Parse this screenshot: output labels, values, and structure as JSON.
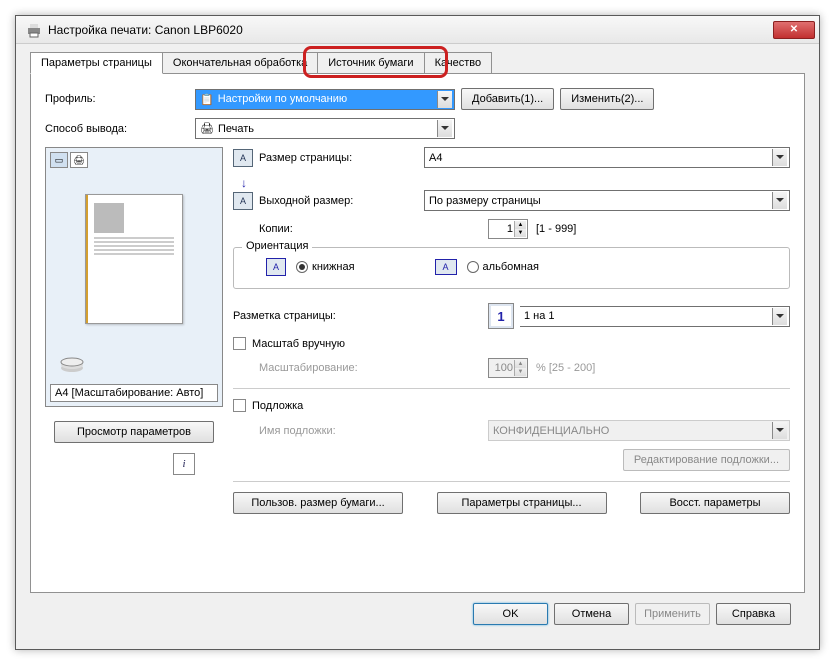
{
  "window": {
    "title": "Настройка печати: Canon LBP6020"
  },
  "tabs": {
    "t0": "Параметры страницы",
    "t1": "Окончательная обработка",
    "t2": "Источник бумаги",
    "t3": "Качество"
  },
  "profile": {
    "label": "Профиль:",
    "value": "Настройки по умолчанию",
    "add_btn": "Добавить(1)...",
    "edit_btn": "Изменить(2)..."
  },
  "output": {
    "label": "Способ вывода:",
    "value": "Печать"
  },
  "preview": {
    "status": "A4 [Масштабирование: Авто]",
    "view_btn": "Просмотр параметров"
  },
  "page_size": {
    "label": "Размер страницы:",
    "value": "A4"
  },
  "output_size": {
    "label": "Выходной размер:",
    "value": "По размеру страницы"
  },
  "copies": {
    "label": "Копии:",
    "value": "1",
    "range": "[1 - 999]"
  },
  "orientation": {
    "legend": "Ориентация",
    "portrait": "книжная",
    "landscape": "альбомная"
  },
  "layout": {
    "label": "Разметка страницы:",
    "icon": "1",
    "value": "1 на 1"
  },
  "manual_scale": {
    "label": "Масштаб вручную",
    "scale_label": "Масштабирование:",
    "value": "100",
    "range": "% [25 - 200]"
  },
  "watermark": {
    "label": "Подложка",
    "name_label": "Имя подложки:",
    "value": "КОНФИДЕНЦИАЛЬНО",
    "edit_btn": "Редактирование подложки..."
  },
  "bottom": {
    "user_size": "Пользов. размер бумаги...",
    "page_params": "Параметры страницы...",
    "restore": "Восст. параметры"
  },
  "dialog_btns": {
    "ok": "OK",
    "cancel": "Отмена",
    "apply": "Применить",
    "help": "Справка"
  }
}
